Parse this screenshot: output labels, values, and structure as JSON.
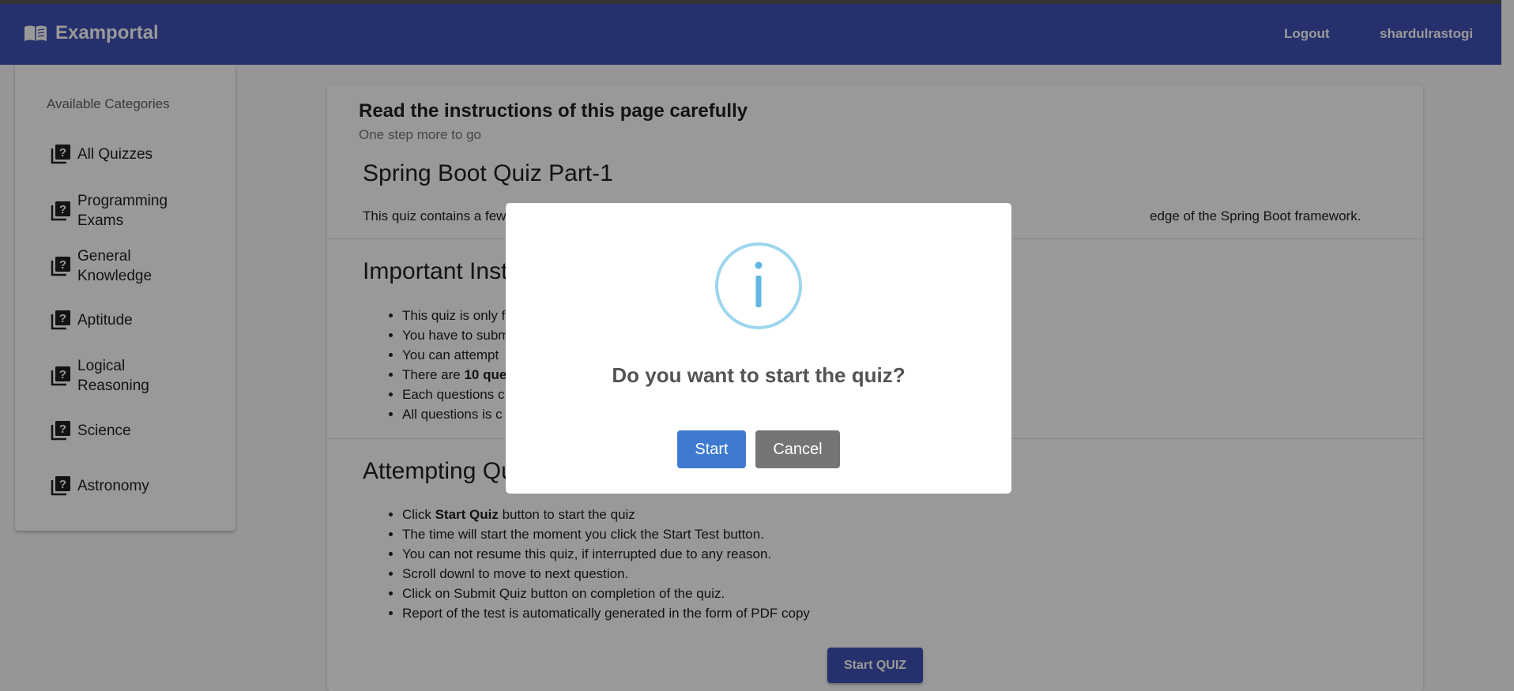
{
  "navbar": {
    "brand": "Examportal",
    "logout": "Logout",
    "username": "shardulrastogi"
  },
  "sidebar": {
    "header": "Available Categories",
    "items": [
      {
        "label": "All Quizzes"
      },
      {
        "label": "Programming Exams"
      },
      {
        "label": "General Knowledge"
      },
      {
        "label": "Aptitude"
      },
      {
        "label": "Logical Reasoning"
      },
      {
        "label": "Science"
      },
      {
        "label": "Astronomy"
      }
    ]
  },
  "main": {
    "title": "Read the instructions of this page carefully",
    "subtitle": "One step more to go",
    "quiz_title": "Spring Boot Quiz Part-1",
    "quiz_desc_start": "This quiz contains a few",
    "quiz_desc_end": "edge of the Spring Boot framework.",
    "important_title": "Important Inst",
    "important_items": [
      {
        "a": "This quiz is only f",
        "b": ""
      },
      {
        "a": "You have to subm",
        "b": ""
      },
      {
        "a": "You can attempt",
        "b": ""
      },
      {
        "a": "There are ",
        "b": "10 que"
      },
      {
        "a": "Each questions c",
        "b": ""
      },
      {
        "a": "All questions is c",
        "b": ""
      }
    ],
    "attempting_title": "Attempting Qu",
    "attempting_first_pre": "Click ",
    "attempting_first_bold": "Start Quiz",
    "attempting_first_post": " button to start the quiz",
    "attempting_items": [
      "The time will start the moment you click the Start Test button.",
      "You can not resume this quiz, if interrupted due to any reason.",
      "Scroll downl to move to next question.",
      "Click on Submit Quiz button on completion of the quiz.",
      "Report of the test is automatically generated in the form of PDF copy"
    ],
    "start_quiz_button": "Start QUIZ"
  },
  "modal": {
    "icon": "info-icon",
    "title": "Do you want to start the quiz?",
    "confirm": "Start",
    "cancel": "Cancel"
  },
  "colors": {
    "primary": "#3f51b5",
    "confirm": "#3e7bd0",
    "cancel": "#757575",
    "info": "#9dd6ee"
  }
}
